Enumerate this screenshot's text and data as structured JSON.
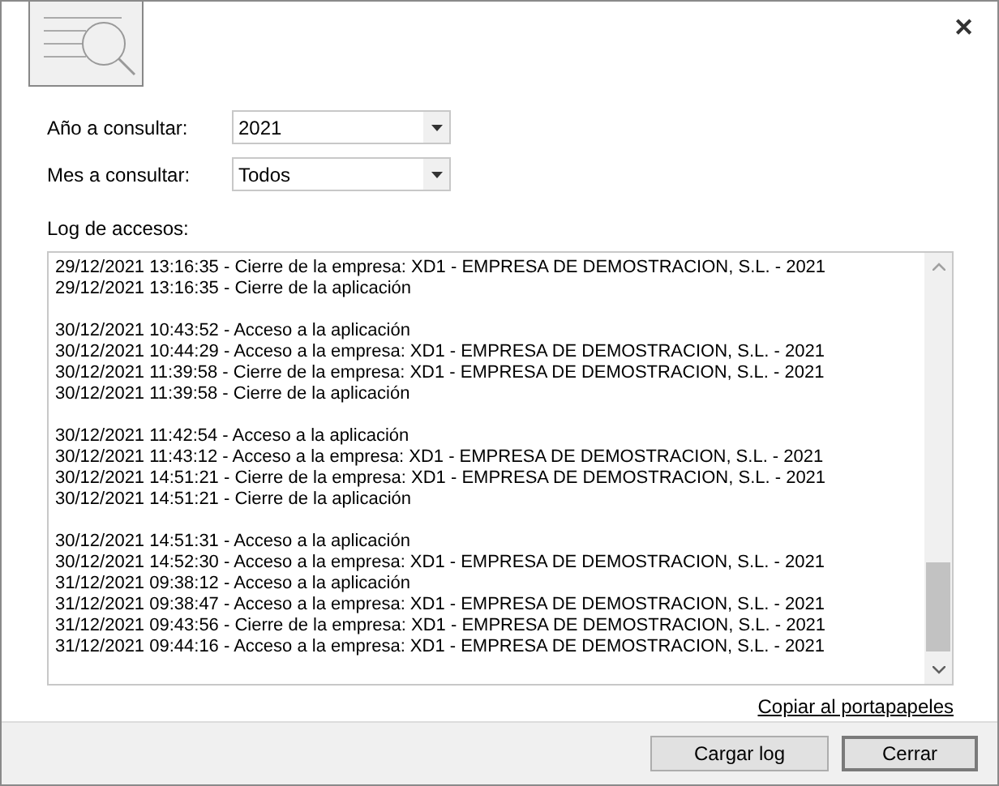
{
  "close_button": "✕",
  "fields": [
    {
      "label": "Año a consultar:",
      "value": "2021"
    },
    {
      "label": "Mes a consultar:",
      "value": "Todos"
    }
  ],
  "log": {
    "label": "Log de accesos:",
    "sessions": [
      [
        "29/12/2021 13:16:35 - Cierre de la empresa: XD1 - EMPRESA DE DEMOSTRACION, S.L. - 2021",
        "29/12/2021 13:16:35 - Cierre de la aplicación"
      ],
      [
        "30/12/2021 10:43:52 - Acceso a la aplicación",
        "30/12/2021 10:44:29 - Acceso a la empresa: XD1 - EMPRESA DE DEMOSTRACION, S.L. - 2021",
        "30/12/2021 11:39:58 - Cierre de la empresa: XD1 - EMPRESA DE DEMOSTRACION, S.L. - 2021",
        "30/12/2021 11:39:58 - Cierre de la aplicación"
      ],
      [
        "30/12/2021 11:42:54 - Acceso a la aplicación",
        "30/12/2021 11:43:12 - Acceso a la empresa: XD1 - EMPRESA DE DEMOSTRACION, S.L. - 2021",
        "30/12/2021 14:51:21 - Cierre de la empresa: XD1 - EMPRESA DE DEMOSTRACION, S.L. - 2021",
        "30/12/2021 14:51:21 - Cierre de la aplicación"
      ],
      [
        "30/12/2021 14:51:31 - Acceso a la aplicación",
        "30/12/2021 14:52:30 - Acceso a la empresa: XD1 - EMPRESA DE DEMOSTRACION, S.L. - 2021",
        "31/12/2021 09:38:12 - Acceso a la aplicación",
        "31/12/2021 09:38:47 - Acceso a la empresa: XD1 - EMPRESA DE DEMOSTRACION, S.L. - 2021",
        "31/12/2021 09:43:56 - Cierre de la empresa: XD1 - EMPRESA DE DEMOSTRACION, S.L. - 2021",
        "31/12/2021 09:44:16 - Acceso a la empresa: XD1 - EMPRESA DE DEMOSTRACION, S.L. - 2021"
      ]
    ]
  },
  "copy_link": "Copiar al portapapeles",
  "buttons": [
    {
      "label": "Cargar log",
      "default": false
    },
    {
      "label": "Cerrar",
      "default": true
    }
  ]
}
